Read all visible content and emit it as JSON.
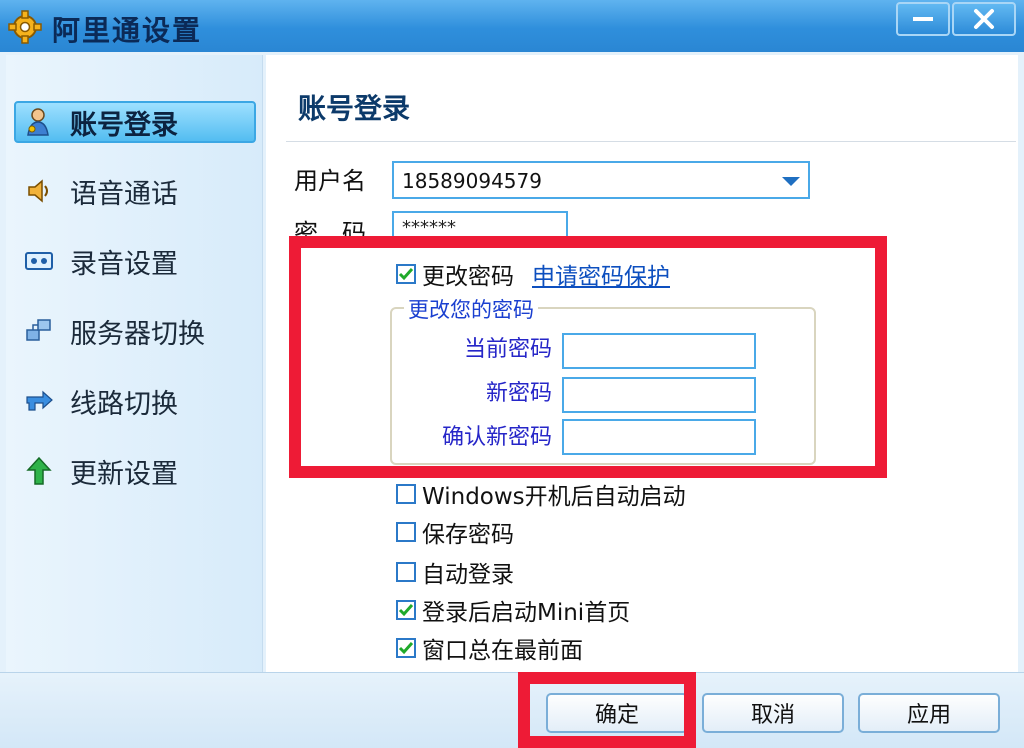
{
  "window": {
    "title": "阿里通设置"
  },
  "sidebar": {
    "items": [
      {
        "label": "账号登录",
        "icon": "user-key-icon",
        "selected": true
      },
      {
        "label": "语音通话",
        "icon": "speaker-icon",
        "selected": false
      },
      {
        "label": "录音设置",
        "icon": "tape-icon",
        "selected": false
      },
      {
        "label": "服务器切换",
        "icon": "network-icon",
        "selected": false
      },
      {
        "label": "线路切换",
        "icon": "route-arrow-icon",
        "selected": false
      },
      {
        "label": "更新设置",
        "icon": "up-arrow-icon",
        "selected": false
      }
    ]
  },
  "content": {
    "section_title": "账号登录",
    "username_label": "用户名",
    "username_value": "18589094579",
    "password_label": "密　码",
    "password_value": "******",
    "change_password": {
      "label": "更改密码",
      "checked": true
    },
    "protect_link": "申请密码保护",
    "group": {
      "title": "更改您的密码",
      "current_label": "当前密码",
      "new_label": "新密码",
      "confirm_label": "确认新密码"
    },
    "options": [
      {
        "label": "Windows开机后自动启动",
        "checked": false
      },
      {
        "label": "保存密码",
        "checked": false
      },
      {
        "label": "自动登录",
        "checked": false
      },
      {
        "label": "登录后启动Mini首页",
        "checked": true
      },
      {
        "label": "窗口总在最前面",
        "checked": true
      }
    ]
  },
  "buttons": {
    "ok": "确定",
    "cancel": "取消",
    "apply": "应用"
  },
  "colors": {
    "annotation": "#ee1b36",
    "titlebar": "#2f8fdc",
    "checkmark": "#1faa2a"
  }
}
